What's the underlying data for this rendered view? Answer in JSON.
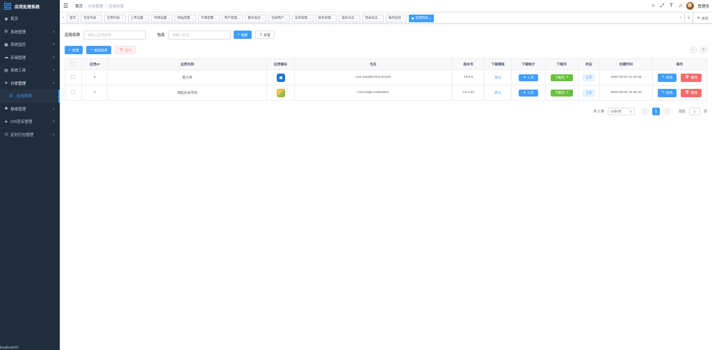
{
  "sidebar": {
    "title": "应用处理系统",
    "items": [
      {
        "label": "首页",
        "icon": "dashboard-icon"
      },
      {
        "label": "系统管理",
        "icon": "gear-icon"
      },
      {
        "label": "系统监控",
        "icon": "monitor-icon"
      },
      {
        "label": "存储管理",
        "icon": "storage-icon"
      },
      {
        "label": "系统工具",
        "icon": "tool-icon"
      },
      {
        "label": "分发管理",
        "icon": "send-icon"
      },
      {
        "label": "应用列表",
        "icon": "list-icon"
      },
      {
        "label": "报毒管理",
        "icon": "bug-icon"
      },
      {
        "label": "iOS签名管理",
        "icon": "send-icon"
      },
      {
        "label": "定时打包管理",
        "icon": "clock-icon"
      }
    ],
    "footer": "localhost:81"
  },
  "navbar": {
    "breadcrumb": [
      "首页",
      "分发管理",
      "应用列表"
    ],
    "username": "管理员"
  },
  "tags": [
    "首页",
    "签名列表",
    "应用列表",
    "上传设置",
    "存储设置",
    "网站配置",
    "引擎配置",
    "用户管理",
    "服务监控",
    "在线用户",
    "菜单管理",
    "角色管理",
    "操作日志",
    "登录日志",
    "缓存监控",
    "应用列表"
  ],
  "tags_right": "关闭",
  "search": {
    "app_name_label": "应用名称",
    "app_name_placeholder": "请输入应用名称",
    "package_label": "包名",
    "package_placeholder": "请输入包名",
    "search_button": "搜索",
    "reset_button": "重置"
  },
  "toolbar": {
    "add_button": "新增",
    "sort_button": "拖动排序",
    "delete_button": "删除"
  },
  "table": {
    "headers": [
      "应用ID",
      "应用名称",
      "应用图标",
      "包名",
      "版本号",
      "下载模板",
      "下载统计",
      "下载页",
      "状态",
      "创建时间",
      "操作"
    ],
    "rows": [
      {
        "id": "6",
        "name": "鲁大师",
        "icon": "ludashi-icon",
        "package": "com.ludashi.benchmark",
        "version": "10.9.6",
        "template": "默认",
        "downloads": "1 次",
        "page": "下载页",
        "status": "正常",
        "created": "2026-06-04 11:42:55",
        "edit": "修改",
        "delete": "删除"
      },
      {
        "id": "4",
        "name": "揭起安卓市场",
        "icon": "market-icon",
        "package": "com.hiapk.marketpho",
        "version": "7.5.1.81",
        "template": "默认",
        "downloads": "0 次",
        "page": "下载页",
        "status": "正常",
        "created": "2026-06-04 10:48:40",
        "edit": "修改",
        "delete": "删除"
      }
    ]
  },
  "pagination": {
    "total": "共 2 条",
    "page_size": "10条/页",
    "current": "1",
    "goto_label": "前往",
    "goto_value": "1",
    "page_suffix": "页"
  },
  "colors": {
    "primary": "#409eff",
    "sidebar": "#1f2d3d",
    "success": "#67c23a",
    "danger": "#f56c6c"
  }
}
